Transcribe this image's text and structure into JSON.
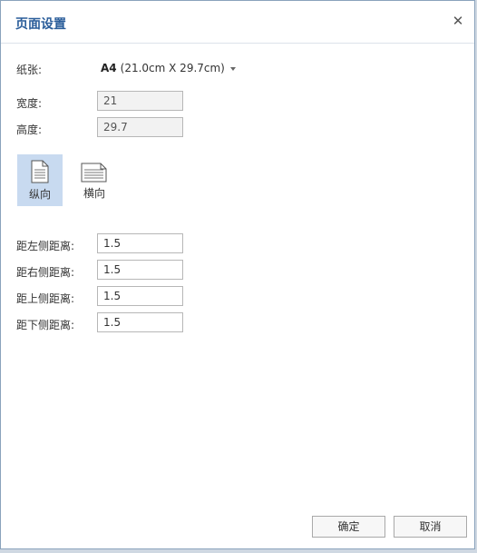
{
  "dialog": {
    "title": "页面设置",
    "close_icon": "close-icon"
  },
  "paper": {
    "label": "纸张:",
    "size": "A4",
    "dimensions": "(21.0cm X 29.7cm)"
  },
  "width": {
    "label": "宽度:",
    "value": "21"
  },
  "height": {
    "label": "高度:",
    "value": "29.7"
  },
  "orientation": {
    "portrait_label": "纵向",
    "landscape_label": "横向",
    "selected": "portrait"
  },
  "margins": {
    "left": {
      "label": "距左侧距离:",
      "value": "1.5"
    },
    "right": {
      "label": "距右侧距离:",
      "value": "1.5"
    },
    "top": {
      "label": "距上侧距离:",
      "value": "1.5"
    },
    "bottom": {
      "label": "距下侧距离:",
      "value": "1.5"
    }
  },
  "buttons": {
    "ok": "确定",
    "cancel": "取消"
  },
  "colors": {
    "title": "#2a5d9a",
    "selected_bg": "#c8daf0"
  }
}
